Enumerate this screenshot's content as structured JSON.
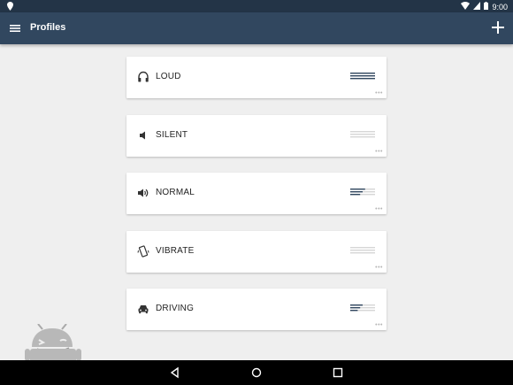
{
  "status_bar": {
    "time": "9:00"
  },
  "app_bar": {
    "title": "Profiles"
  },
  "profiles": [
    {
      "name": "LOUD",
      "icon": "headphones-icon",
      "volume_level": 1.0,
      "more": "•••"
    },
    {
      "name": "SILENT",
      "icon": "speaker-icon",
      "volume_level": 0.0,
      "more": "•••"
    },
    {
      "name": "NORMAL",
      "icon": "speaker-volume-icon",
      "volume_level": 0.6,
      "more": "•••"
    },
    {
      "name": "VIBRATE",
      "icon": "vibrate-phone-icon",
      "volume_level": 0.0,
      "more": "•••"
    },
    {
      "name": "DRIVING",
      "icon": "car-icon",
      "volume_level": 0.5,
      "more": "•••"
    }
  ],
  "colors": {
    "status_bar": "#233447",
    "app_bar": "#31475f",
    "level_active": "#31475f",
    "level_inactive": "#d6d6d6",
    "background": "#efefef"
  }
}
